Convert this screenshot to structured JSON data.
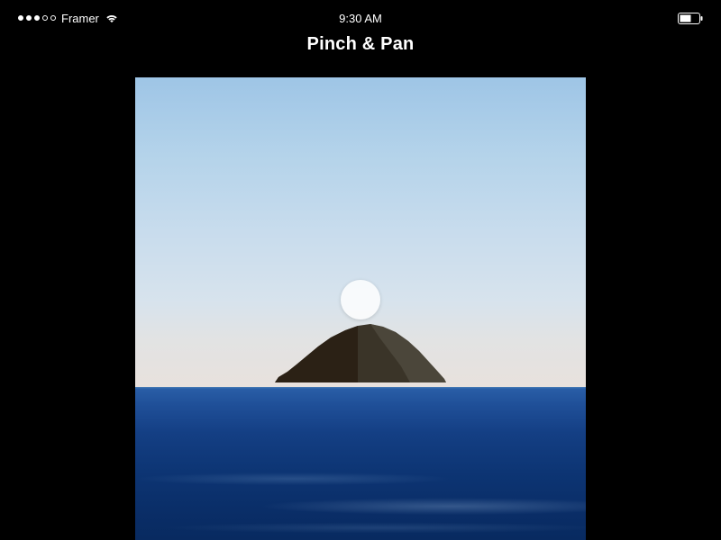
{
  "status_bar": {
    "carrier": "Framer",
    "time": "9:30 AM",
    "signal_filled": 3,
    "signal_total": 5,
    "battery_level": 0.55
  },
  "header": {
    "title": "Pinch & Pan"
  }
}
